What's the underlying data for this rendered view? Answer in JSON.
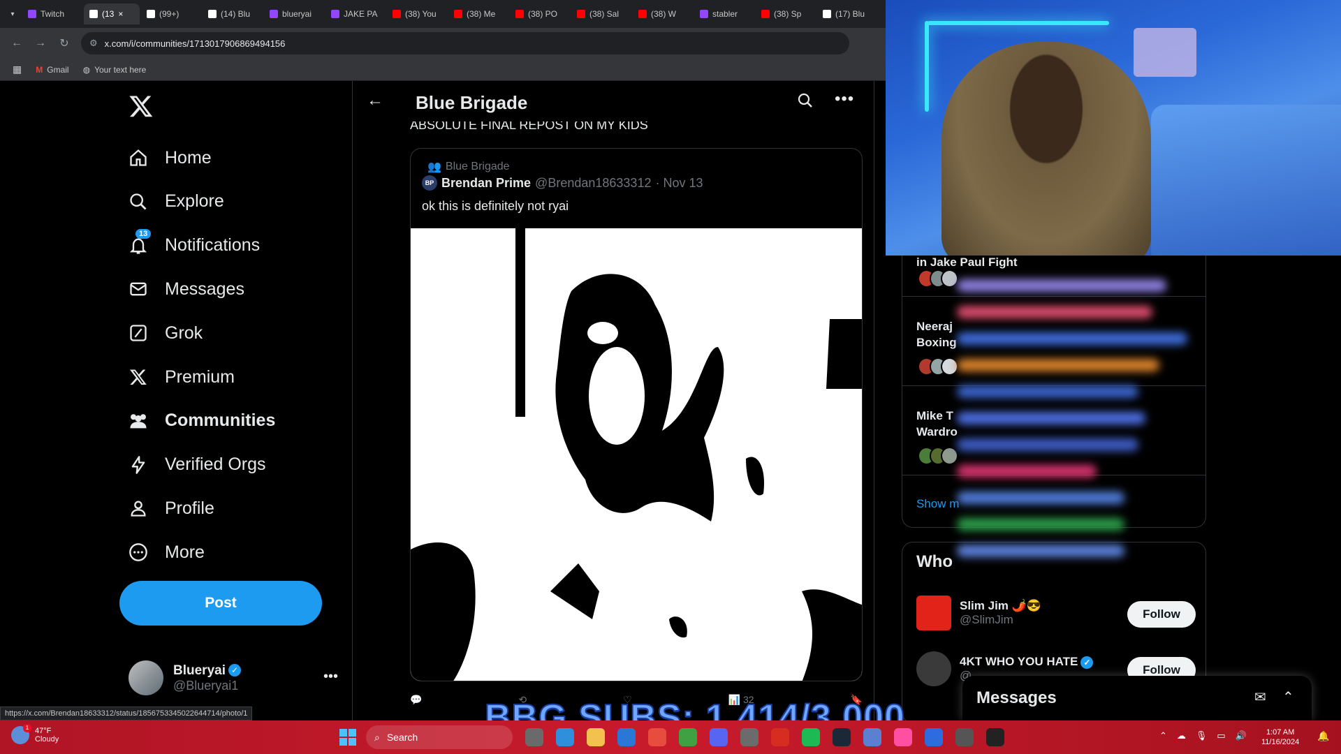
{
  "browser": {
    "tabs": [
      {
        "label": "Twitch",
        "icon": "twitch-icon",
        "color": "#9146ff"
      },
      {
        "label": "(13",
        "icon": "x-icon",
        "color": "#ffffff",
        "active": true
      },
      {
        "label": "(99+)",
        "icon": "tiktok-icon",
        "color": "#ffffff"
      },
      {
        "label": "(14) Blu",
        "icon": "x-icon",
        "color": "#ffffff"
      },
      {
        "label": "blueryai",
        "icon": "twitch-icon",
        "color": "#9146ff"
      },
      {
        "label": "JAKE PA",
        "icon": "twitch-icon",
        "color": "#9146ff"
      },
      {
        "label": "(38) You",
        "icon": "youtube-icon",
        "color": "#ff0000"
      },
      {
        "label": "(38) Me",
        "icon": "youtube-icon",
        "color": "#ff0000"
      },
      {
        "label": "(38) PO",
        "icon": "youtube-icon",
        "color": "#ff0000"
      },
      {
        "label": "(38) Sal",
        "icon": "youtube-icon",
        "color": "#ff0000"
      },
      {
        "label": "(38) W",
        "icon": "youtube-icon",
        "color": "#ff0000"
      },
      {
        "label": "stabler",
        "icon": "twitch-icon",
        "color": "#9146ff"
      },
      {
        "label": "(38) Sp",
        "icon": "youtube-icon",
        "color": "#ff0000"
      },
      {
        "label": "(17) Blu",
        "icon": "x-icon",
        "color": "#ffffff"
      }
    ],
    "url": "x.com/i/communities/1713017906869494156",
    "bookmarks": [
      "Gmail",
      "Your text here"
    ],
    "status_url": "https://x.com/Brendan18633312/status/1856753345022644714/photo/1"
  },
  "nav": {
    "items": [
      {
        "label": "Home",
        "icon": "home-icon"
      },
      {
        "label": "Explore",
        "icon": "search-icon"
      },
      {
        "label": "Notifications",
        "icon": "bell-icon",
        "badge": "13"
      },
      {
        "label": "Messages",
        "icon": "mail-icon"
      },
      {
        "label": "Grok",
        "icon": "grok-icon"
      },
      {
        "label": "Premium",
        "icon": "x-icon"
      },
      {
        "label": "Communities",
        "icon": "communities-icon",
        "active": true
      },
      {
        "label": "Verified Orgs",
        "icon": "lightning-icon"
      },
      {
        "label": "Profile",
        "icon": "profile-icon"
      },
      {
        "label": "More",
        "icon": "more-icon"
      }
    ],
    "post_label": "Post",
    "account": {
      "name": "Blueryai",
      "handle": "@Blueryai1"
    }
  },
  "main": {
    "title": "Blue Brigade",
    "prev_text": "ABSOLUTE FINAL REPOST ON MY KIDS",
    "quote": {
      "community": "Blue Brigade",
      "avatar_text": "BP",
      "author": "Brendan Prime",
      "handle": "@Brendan18633312",
      "date": "· Nov 13",
      "text": "ok this is definitely not ryai"
    },
    "actions": {
      "views": "32"
    }
  },
  "sidebar": {
    "trend1": "in Jake Paul Fight",
    "trend2a": "Neeraj",
    "trend2b": "Boxing",
    "trend3a": "Mike T",
    "trend3b": "Wardro",
    "show_more": "Show m",
    "who_title": "Who",
    "follow_label": "Follow",
    "accounts": [
      {
        "name": "Slim Jim 🌶️😎",
        "handle": "@SlimJim",
        "color": "#e2231a"
      },
      {
        "name": "4KT WHO YOU HATE",
        "handle": "@",
        "color": "#3a3a3a"
      }
    ],
    "messages_title": "Messages"
  },
  "overlay": {
    "subs": "BBG SUBS: 1,414/3,000"
  },
  "taskbar": {
    "temp": "47°F",
    "condition": "Cloudy",
    "weather_badge": "1",
    "search": "Search",
    "time": "1:07 AM",
    "date": "11/16/2024"
  }
}
